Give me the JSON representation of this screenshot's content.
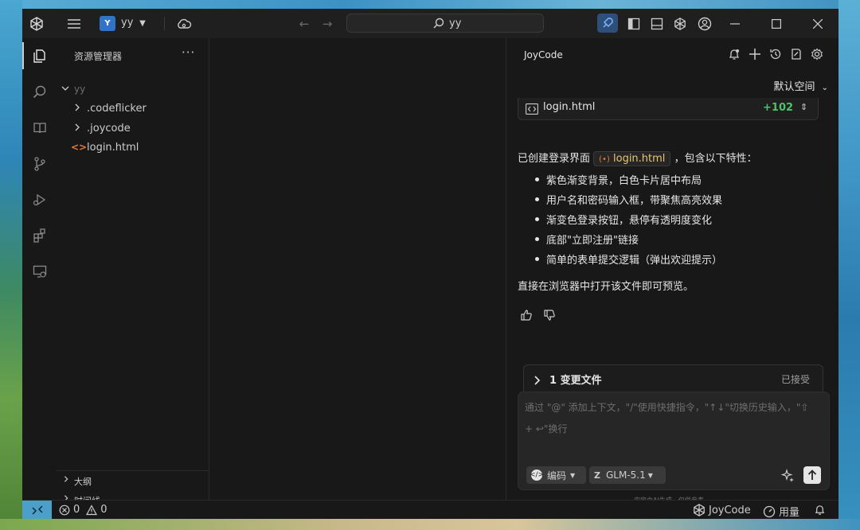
{
  "titlebar": {
    "project_badge": "Y",
    "project_name": "yy",
    "search_text": "yy"
  },
  "sidebar": {
    "title": "资源管理器",
    "more": "···",
    "root": "yy",
    "items": [
      {
        "label": ".codeflicker",
        "type": "folder"
      },
      {
        "label": ".joycode",
        "type": "folder"
      },
      {
        "label": "login.html",
        "type": "file"
      }
    ],
    "outline": "大纲",
    "timeline": "时间线"
  },
  "chat": {
    "title": "JoyCode",
    "workspace": "默认空间",
    "file_card": {
      "name": "login.html",
      "changes": "+102"
    },
    "message_prefix": "已创建登录界面",
    "message_file": "login.html",
    "message_suffix": "，包含以下特性：",
    "bullets": [
      "紫色渐变背景，白色卡片居中布局",
      "用户名和密码输入框，带聚焦高亮效果",
      "渐变色登录按钮，悬停有透明度变化",
      "底部\"立即注册\"链接",
      "简单的表单提交逻辑（弹出欢迎提示）"
    ],
    "closing": "直接在浏览器中打开该文件即可预览。",
    "changes_label": "1 变更文件",
    "changes_status": "已接受",
    "input_placeholder": "通过 \"@\" 添加上下文，\"/\"使用快捷指令，\"↑↓\"切换历史输入，\"⇧ + ↩\"换行",
    "mode": "编码",
    "model": "GLM-5.1",
    "disclaimer": "内容由AI生成，仅供参考"
  },
  "statusbar": {
    "errors": "0",
    "warnings": "0",
    "brand": "JoyCode",
    "usage": "用量"
  },
  "colors": {
    "accent": "#3173c4",
    "added": "#4ec06a",
    "chip_text": "#e8c56e",
    "remote": "#4c9fc9"
  }
}
